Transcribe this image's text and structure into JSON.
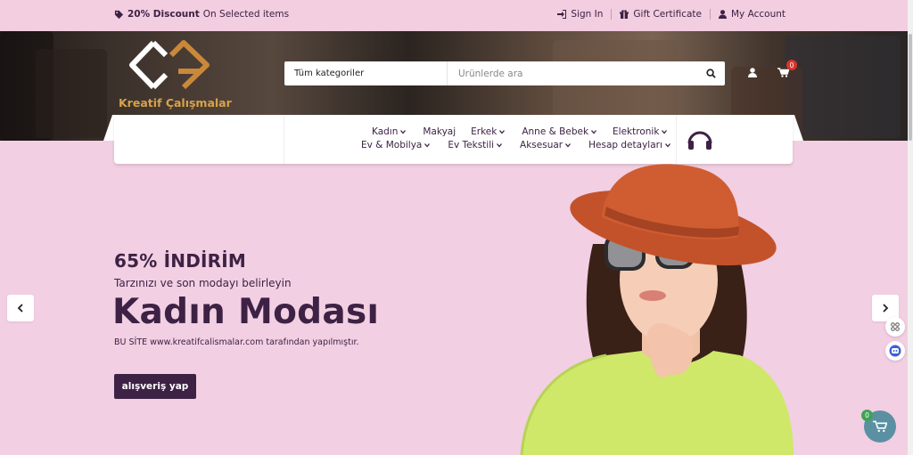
{
  "topbar": {
    "promo_bold": "20% Discount",
    "promo_rest": "On Selected items",
    "links": [
      {
        "icon": "sign-in-icon",
        "label": "Sign In"
      },
      {
        "icon": "gift-icon",
        "label": "Gift Certificate"
      },
      {
        "icon": "user-icon",
        "label": "My Account"
      }
    ]
  },
  "brand": {
    "name": "Kreatif Çalışmalar",
    "logo_colors": [
      "#ffffff",
      "#c9883a"
    ]
  },
  "search": {
    "category": "Tüm kategoriler",
    "placeholder": "Ürünlerde ara"
  },
  "cart": {
    "count": "0"
  },
  "menu": {
    "row1": [
      "Kadın",
      "Makyaj",
      "Erkek",
      "Anne & Bebek",
      "Elektronik"
    ],
    "row2": [
      "Ev & Mobilya",
      "Ev Tekstili",
      "Aksesuar",
      "Hesap detayları"
    ]
  },
  "hero": {
    "discount": "65% İNDİRİM",
    "subtitle": "Tarzınızı ve son modayı belirleyin",
    "title": "Kadın Modası",
    "note": "BU SİTE www.kreatifcalismalar.com tarafından yapılmıştır.",
    "button": "alışveriş yap"
  },
  "floating_cart": {
    "count": "0"
  },
  "colors": {
    "accent": "#3d2245",
    "background": "#f2cfe2",
    "brand_gold": "#d8a24a",
    "fab": "#5b90a3"
  }
}
